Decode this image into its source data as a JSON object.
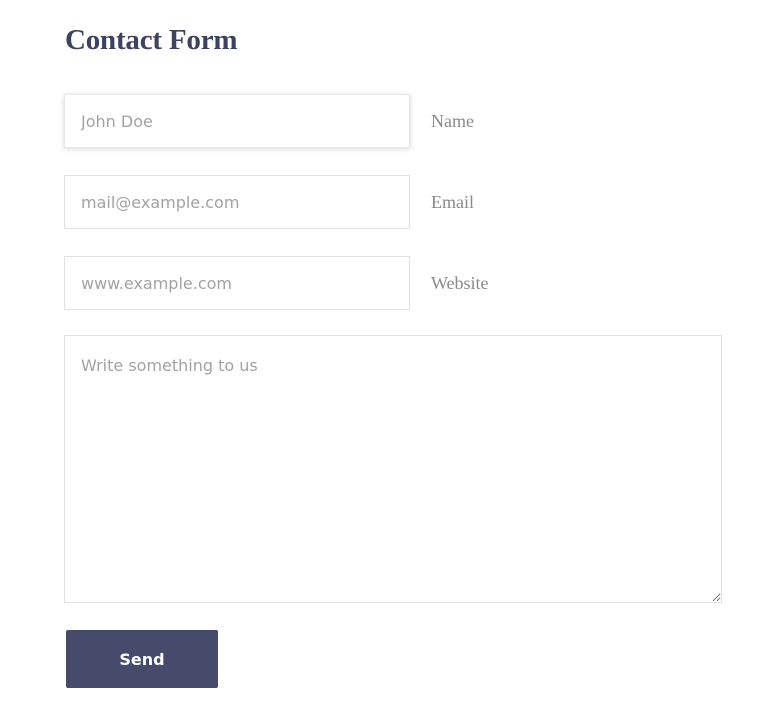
{
  "form": {
    "title": "Contact Form",
    "fields": [
      {
        "label": "Name",
        "placeholder": "John Doe",
        "value": ""
      },
      {
        "label": "Email",
        "placeholder": "mail@example.com",
        "value": ""
      },
      {
        "label": "Website",
        "placeholder": "www.example.com",
        "value": ""
      }
    ],
    "message": {
      "placeholder": "Write something to us",
      "value": ""
    },
    "submit_label": "Send"
  },
  "colors": {
    "title": "#3d4260",
    "button_bg": "#474b6b",
    "button_text": "#ffffff",
    "label": "#8a8a8a",
    "placeholder": "#a2a2a2",
    "border": "#e2e2e2"
  }
}
